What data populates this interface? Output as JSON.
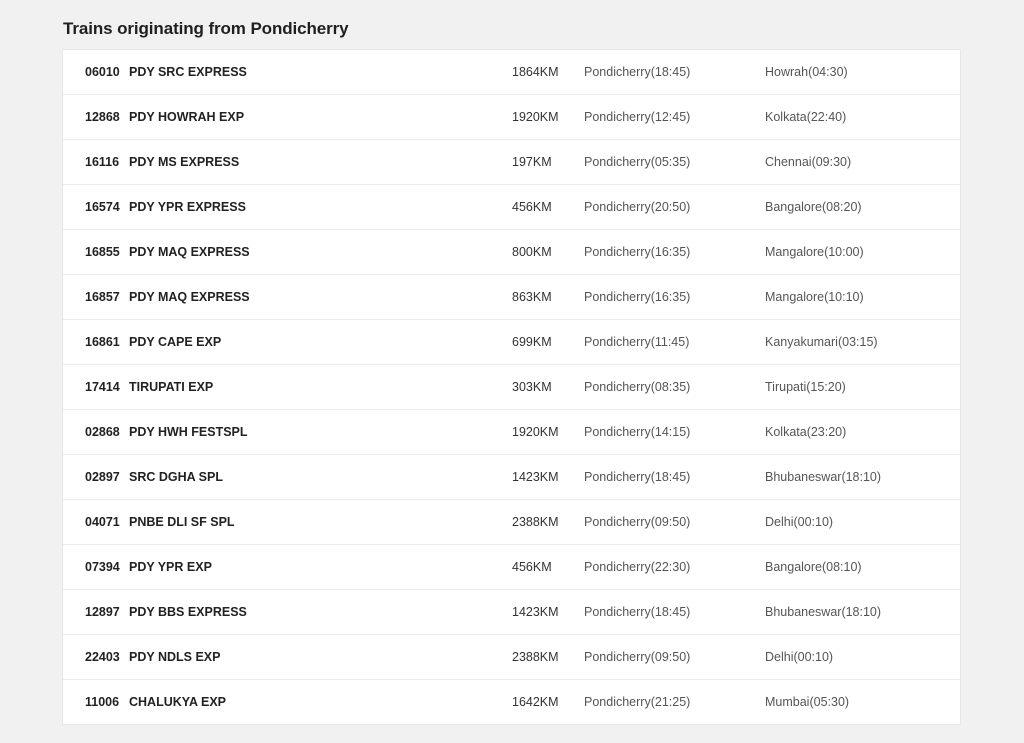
{
  "section": {
    "title": "Trains originating from Pondicherry"
  },
  "trains": [
    {
      "number": "06010",
      "name": "PDY SRC EXPRESS",
      "distance": "1864KM",
      "source": "Pondicherry(18:45)",
      "destination": "Howrah(04:30)"
    },
    {
      "number": "12868",
      "name": "PDY HOWRAH EXP",
      "distance": "1920KM",
      "source": "Pondicherry(12:45)",
      "destination": "Kolkata(22:40)"
    },
    {
      "number": "16116",
      "name": "PDY MS EXPRESS",
      "distance": "197KM",
      "source": "Pondicherry(05:35)",
      "destination": "Chennai(09:30)"
    },
    {
      "number": "16574",
      "name": "PDY YPR EXPRESS",
      "distance": "456KM",
      "source": "Pondicherry(20:50)",
      "destination": "Bangalore(08:20)"
    },
    {
      "number": "16855",
      "name": "PDY MAQ EXPRESS",
      "distance": "800KM",
      "source": "Pondicherry(16:35)",
      "destination": "Mangalore(10:00)"
    },
    {
      "number": "16857",
      "name": "PDY MAQ EXPRESS",
      "distance": "863KM",
      "source": "Pondicherry(16:35)",
      "destination": "Mangalore(10:10)"
    },
    {
      "number": "16861",
      "name": "PDY CAPE EXP",
      "distance": "699KM",
      "source": "Pondicherry(11:45)",
      "destination": "Kanyakumari(03:15)"
    },
    {
      "number": "17414",
      "name": "TIRUPATI EXP",
      "distance": "303KM",
      "source": "Pondicherry(08:35)",
      "destination": "Tirupati(15:20)"
    },
    {
      "number": "02868",
      "name": "PDY HWH FESTSPL",
      "distance": "1920KM",
      "source": "Pondicherry(14:15)",
      "destination": "Kolkata(23:20)"
    },
    {
      "number": "02897",
      "name": "SRC DGHA SPL",
      "distance": "1423KM",
      "source": "Pondicherry(18:45)",
      "destination": "Bhubaneswar(18:10)"
    },
    {
      "number": "04071",
      "name": "PNBE DLI SF SPL",
      "distance": "2388KM",
      "source": "Pondicherry(09:50)",
      "destination": "Delhi(00:10)"
    },
    {
      "number": "07394",
      "name": "PDY YPR EXP",
      "distance": "456KM",
      "source": "Pondicherry(22:30)",
      "destination": "Bangalore(08:10)"
    },
    {
      "number": "12897",
      "name": "PDY BBS EXPRESS",
      "distance": "1423KM",
      "source": "Pondicherry(18:45)",
      "destination": "Bhubaneswar(18:10)"
    },
    {
      "number": "22403",
      "name": "PDY NDLS EXP",
      "distance": "2388KM",
      "source": "Pondicherry(09:50)",
      "destination": "Delhi(00:10)"
    },
    {
      "number": "11006",
      "name": "CHALUKYA EXP",
      "distance": "1642KM",
      "source": "Pondicherry(21:25)",
      "destination": "Mumbai(05:30)"
    }
  ]
}
